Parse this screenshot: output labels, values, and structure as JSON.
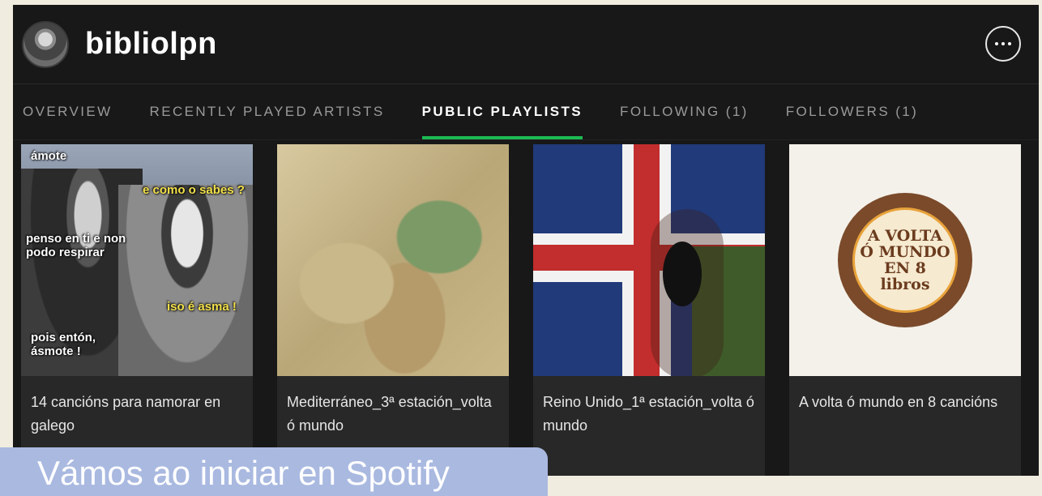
{
  "profile": {
    "username": "bibliolpn"
  },
  "tabs": [
    {
      "label": "OVERVIEW",
      "active": false
    },
    {
      "label": "RECENTLY PLAYED ARTISTS",
      "active": false
    },
    {
      "label": "PUBLIC PLAYLISTS",
      "active": true
    },
    {
      "label": "FOLLOWING (1)",
      "active": false
    },
    {
      "label": "FOLLOWERS (1)",
      "active": false
    }
  ],
  "playlists": [
    {
      "title": "14 cancións para namorar en galego",
      "cover_text": [
        "ámote",
        "e como o sabes ?",
        "penso en ti e non podo respirar",
        "iso é asma !",
        "pois entón, ásmote !"
      ]
    },
    {
      "title": "Mediterráneo_3ª estación_volta ó mundo"
    },
    {
      "title": "Reino Unido_1ª estación_volta ó mundo"
    },
    {
      "title": "A volta ó mundo en 8 cancións",
      "cover_text": [
        "A VOLTA",
        "Ó MUNDO",
        "EN 8",
        "libros"
      ]
    }
  ],
  "overlay_text": "Vámos ao iniciar en Spotify",
  "colors": {
    "accent": "#1db954",
    "background": "#181818",
    "card": "#282828"
  }
}
